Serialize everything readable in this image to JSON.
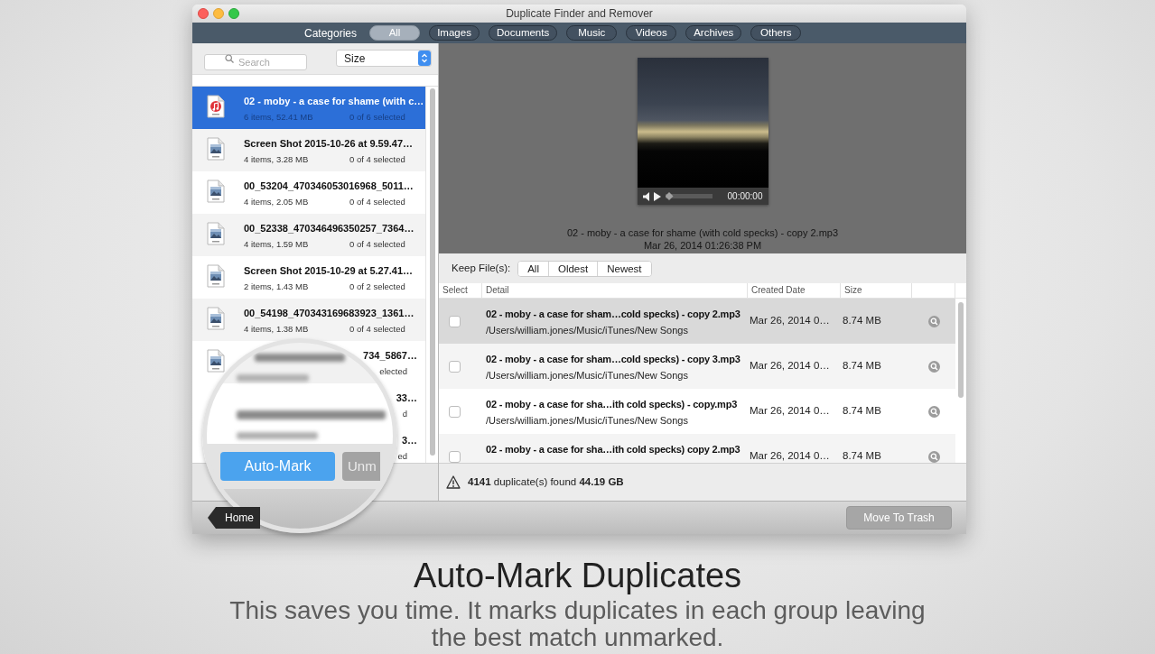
{
  "window": {
    "title": "Duplicate Finder and Remover"
  },
  "category_bar": {
    "label": "Categories",
    "tabs": [
      {
        "label": "All",
        "selected": true
      },
      {
        "label": "Images",
        "selected": false
      },
      {
        "label": "Documents",
        "selected": false
      },
      {
        "label": "Music",
        "selected": false
      },
      {
        "label": "Videos",
        "selected": false
      },
      {
        "label": "Archives",
        "selected": false
      },
      {
        "label": "Others",
        "selected": false
      }
    ]
  },
  "sidebar": {
    "search": {
      "placeholder": "Search"
    },
    "sort": {
      "value": "Size"
    },
    "groups": [
      {
        "kind": "audio",
        "name": "02 - moby - a case for shame (with c…",
        "summary": "6 items, 52.41 MB",
        "status": "0 of 6 selected",
        "selected": true
      },
      {
        "kind": "image",
        "name": "Screen Shot 2015-10-26 at 9.59.47…",
        "summary": "4 items, 3.28 MB",
        "status": "0 of 4 selected",
        "selected": false
      },
      {
        "kind": "image",
        "name": "00_53204_470346053016968_5011…",
        "summary": "4 items, 2.05 MB",
        "status": "0 of 4 selected",
        "selected": false
      },
      {
        "kind": "image",
        "name": "00_52338_470346496350257_7364…",
        "summary": "4 items, 1.59 MB",
        "status": "0 of 4 selected",
        "selected": false
      },
      {
        "kind": "image",
        "name": "Screen Shot 2015-10-29 at 5.27.41…",
        "summary": "2 items, 1.43 MB",
        "status": "0 of 2 selected",
        "selected": false
      },
      {
        "kind": "image",
        "name": "00_54198_470343169683923_1361…",
        "summary": "4 items, 1.38 MB",
        "status": "0 of 4 selected",
        "selected": false
      }
    ],
    "partly_hidden_groups": [
      {
        "kind": "image",
        "name": "734_5867…",
        "status": "elected"
      },
      {
        "kind": "hidden",
        "name": "33…",
        "status": "d"
      },
      {
        "kind": "hidden",
        "name": "3…",
        "status": "ed"
      }
    ],
    "actions": [
      {
        "kind": "primary",
        "label": "Auto-Mark"
      },
      {
        "kind": "secondary",
        "label": "Unm"
      }
    ]
  },
  "preview": {
    "file": "02 - moby - a case for shame (with cold specks) - copy 2.mp3",
    "date": "Mar 26, 2014 01:26:38 PM",
    "player": {
      "time": "00:00:00",
      "level": 0
    }
  },
  "keep_files": {
    "label": "Keep File(s):",
    "options": [
      {
        "label": "All",
        "selected": false
      },
      {
        "label": "Oldest",
        "selected": false
      },
      {
        "label": "Newest",
        "selected": false
      }
    ]
  },
  "table": {
    "columns": [
      "Select",
      "Detail",
      "Created Date",
      "Size"
    ],
    "rows": [
      {
        "selected": true,
        "checked": false,
        "name": "02 - moby - a case for sham…cold specks) - copy 2.mp3",
        "path": "/Users/william.jones/Music/iTunes/New Songs",
        "created": "Mar 26, 2014 0…",
        "size": "8.74 MB"
      },
      {
        "selected": false,
        "checked": false,
        "name": "02 - moby - a case for sham…cold specks) - copy 3.mp3",
        "path": "/Users/william.jones/Music/iTunes/New Songs",
        "created": "Mar 26, 2014 0…",
        "size": "8.74 MB"
      },
      {
        "selected": false,
        "checked": false,
        "name": "02 - moby - a case for sha…ith cold specks) - copy.mp3",
        "path": "/Users/william.jones/Music/iTunes/New Songs",
        "created": "Mar 26, 2014 0…",
        "size": "8.74 MB"
      },
      {
        "selected": false,
        "checked": false,
        "name": "02 - moby - a case for sha…ith cold specks) copy 2.mp3",
        "created": "Mar 26, 2014 0…",
        "size": "8.74 MB"
      }
    ]
  },
  "status_bar": {
    "text": "**4141** duplicate(s) found **44.19 GB**"
  },
  "bottom_bar": {
    "home": "Home",
    "move_to_trash": {
      "label": "Move To Trash",
      "disabled": true
    }
  },
  "caption": {
    "title": "Auto-Mark Duplicates",
    "text": "This saves you time. It marks duplicates in each group leaving the best match unmarked."
  }
}
